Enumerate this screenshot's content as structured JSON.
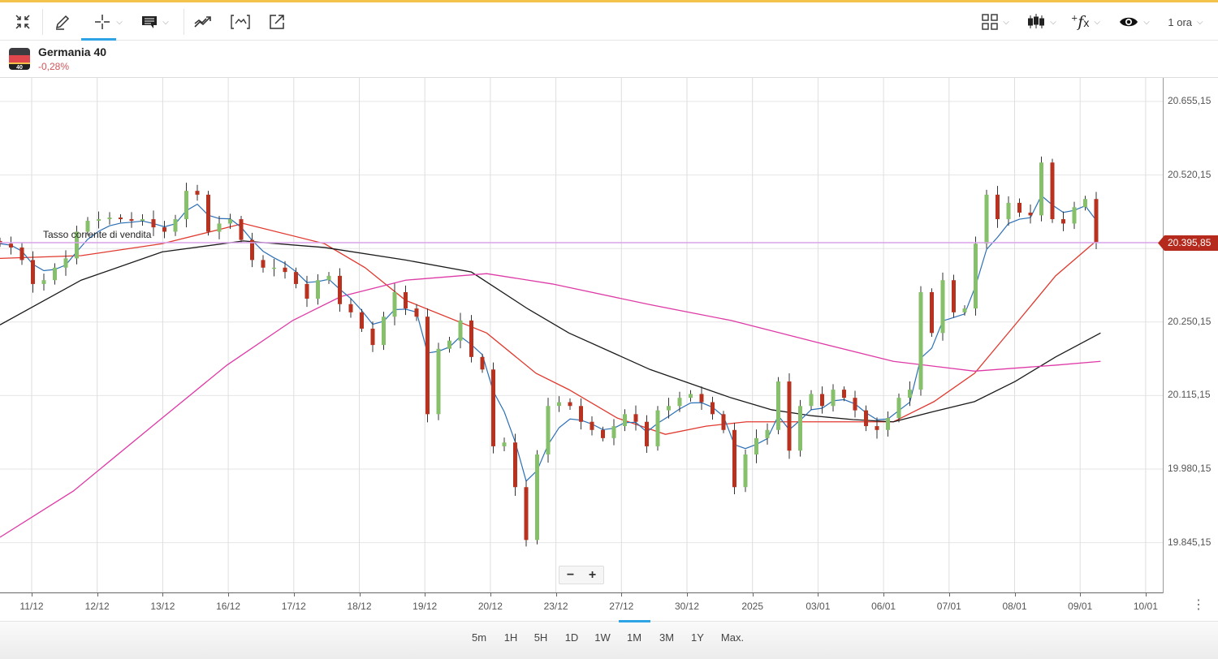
{
  "toolbar": {
    "left": [
      {
        "icon": "collapse-icon"
      },
      {
        "icon": "pencil-icon"
      },
      {
        "icon": "crosshair-icon",
        "has_menu": true,
        "active": true
      },
      {
        "icon": "comment-icon",
        "has_menu": true
      },
      {
        "icon": "trend-icon"
      },
      {
        "icon": "indicator-icon"
      },
      {
        "icon": "external-link-icon"
      }
    ],
    "right": {
      "layout": "grid-icon",
      "chart_type": "candlestick-icon",
      "functions": "fx-icon",
      "view": "eye-icon",
      "interval": "1 ora"
    }
  },
  "instrument": {
    "name": "Germania 40",
    "change": "-0,28%",
    "flag_label": "40"
  },
  "current_price": {
    "label": "Tasso corrente di vendita",
    "value": "20.395,85",
    "price": 20395.85
  },
  "zoom": {
    "minus": "−",
    "plus": "+"
  },
  "more_menu": "⋮",
  "timeframes": {
    "items": [
      "5m",
      "1H",
      "5H",
      "1D",
      "1W",
      "1M",
      "3M",
      "1Y",
      "Max."
    ],
    "active": "1M"
  },
  "colors": {
    "up": "#86c06a",
    "down": "#b8321f",
    "ma_fast": "#2c6fb5",
    "ma_mid": "#e0392e",
    "ma_slow": "#1a1a1a",
    "ma_long": "#de3aa6",
    "current": "#d9a3ea"
  },
  "chart_data": {
    "type": "candlestick",
    "interval": "1 ora",
    "y_ticks": [
      "20.655,15",
      "20.520,15",
      "20.250,15",
      "20.115,15",
      "19.980,15",
      "19.845,15"
    ],
    "y_tick_values": [
      20655.15,
      20520.15,
      20385.15,
      20250.15,
      20115.15,
      19980.15,
      19845.15
    ],
    "x_ticks": [
      "11/12",
      "12/12",
      "13/12",
      "16/12",
      "17/12",
      "18/12",
      "19/12",
      "20/12",
      "23/12",
      "27/12",
      "30/12",
      "2025",
      "03/01",
      "06/01",
      "07/01",
      "08/01",
      "09/01",
      "10/01"
    ],
    "closes": [
      20394,
      20387,
      20364,
      20320,
      20327,
      20350,
      20367,
      20416,
      20436,
      20439,
      20442,
      20439,
      20436,
      20439,
      20424,
      20416,
      20439,
      20491,
      20484,
      20416,
      20431,
      20439,
      20401,
      20364,
      20350,
      20350,
      20342,
      20320,
      20293,
      20327,
      20335,
      20283,
      20268,
      20238,
      20208,
      20260,
      20305,
      20275,
      20260,
      20081,
      20201,
      20216,
      20253,
      20186,
      20163,
      20022,
      20029,
      19947,
      19850,
      20007,
      20096,
      20103,
      20096,
      20067,
      20052,
      20037,
      20059,
      20081,
      20067,
      20022,
      20088,
      20096,
      20111,
      20118,
      20103,
      20081,
      20052,
      19947,
      20007,
      20037,
      20052,
      20141,
      20014,
      20096,
      20118,
      20096,
      20126,
      20111,
      20088,
      20059,
      20052,
      20074,
      20111,
      20126,
      20305,
      20230,
      20327,
      20268,
      20275,
      20394,
      20484,
      20439,
      20469,
      20451,
      20446,
      20543,
      20439,
      20431,
      20461,
      20476,
      20397
    ],
    "moving_averages": [
      {
        "name": "ma_mid",
        "points": [
          [
            0,
            20367
          ],
          [
            7.4,
            20372
          ],
          [
            14.8,
            20394
          ],
          [
            22.2,
            20431
          ],
          [
            29.6,
            20394
          ],
          [
            33.3,
            20350
          ],
          [
            37,
            20290
          ],
          [
            44.4,
            20230
          ],
          [
            48.9,
            20156
          ],
          [
            51.9,
            20126
          ],
          [
            56.3,
            20074
          ],
          [
            60.7,
            20044
          ],
          [
            64.4,
            20059
          ],
          [
            68.1,
            20067
          ],
          [
            74.1,
            20067
          ],
          [
            81.5,
            20067
          ],
          [
            85.2,
            20104
          ],
          [
            88.9,
            20156
          ],
          [
            92.6,
            20245
          ],
          [
            96.3,
            20335
          ],
          [
            100,
            20399
          ]
        ]
      },
      {
        "name": "ma_slow",
        "points": [
          [
            0,
            20245
          ],
          [
            7.4,
            20327
          ],
          [
            14.8,
            20379
          ],
          [
            22.2,
            20399
          ],
          [
            29.6,
            20387
          ],
          [
            37,
            20364
          ],
          [
            43,
            20342
          ],
          [
            48.1,
            20275
          ],
          [
            51.9,
            20230
          ],
          [
            59.3,
            20163
          ],
          [
            66.7,
            20111
          ],
          [
            70.4,
            20089
          ],
          [
            74.1,
            20078
          ],
          [
            77.8,
            20071
          ],
          [
            81.5,
            20067
          ],
          [
            85.2,
            20086
          ],
          [
            88.9,
            20104
          ],
          [
            92.6,
            20141
          ],
          [
            96.3,
            20186
          ],
          [
            100.4,
            20230
          ]
        ]
      },
      {
        "name": "ma_long",
        "points": [
          [
            0,
            19855
          ],
          [
            6.7,
            19940
          ],
          [
            14.8,
            20074
          ],
          [
            20.7,
            20171
          ],
          [
            26.7,
            20253
          ],
          [
            31.1,
            20297
          ],
          [
            37,
            20327
          ],
          [
            44.4,
            20339
          ],
          [
            50.4,
            20320
          ],
          [
            59.3,
            20282
          ],
          [
            66.7,
            20253
          ],
          [
            74.1,
            20215
          ],
          [
            81.5,
            20178
          ],
          [
            88.9,
            20160
          ],
          [
            96.3,
            20171
          ],
          [
            100.4,
            20178
          ]
        ]
      }
    ]
  }
}
